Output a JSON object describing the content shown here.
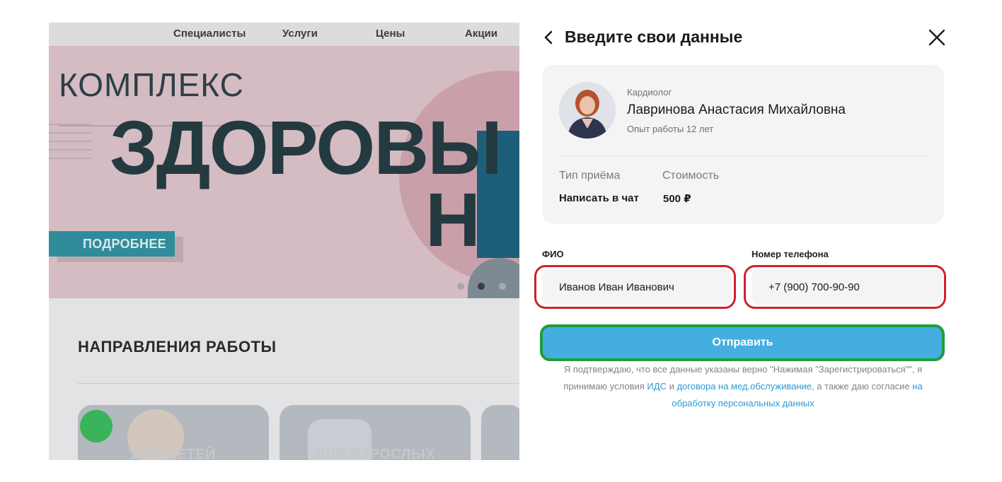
{
  "site": {
    "nav": [
      "Специалисты",
      "Услуги",
      "Цены",
      "Акции"
    ],
    "banner": {
      "small_title": "КОМПЛЕКС",
      "big_title": "ЗДОРОВЫ",
      "big_title2": "Н",
      "button": "ПОДРОБНЕЕ"
    },
    "section_title": "НАПРАВЛЕНИЯ РАБОТЫ",
    "cards": [
      "ДЛЯ ДЕТЕЙ",
      "ДЛЯ ВЗРОСЛЫХ"
    ]
  },
  "form": {
    "title": "Введите свои данные",
    "doctor": {
      "specialty": "Кардиолог",
      "name": "Лавринова Анастасия Михайловна",
      "experience": "Опыт работы 12 лет"
    },
    "appointment": {
      "type_label": "Тип приёма",
      "type_value": "Написать в чат",
      "cost_label": "Стоимость",
      "cost_value": "500 ₽"
    },
    "fields": {
      "name_label": "ФИО",
      "name_value": "Иванов Иван Иванович",
      "phone_label": "Номер телефона",
      "phone_value": "+7 (900) 700-90-90"
    },
    "submit_label": "Отправить",
    "consent": {
      "text1": "Я подтверждаю, что все данные указаны верно \"Нажимая \"Зарегистрироваться\"\", я принимаю условия ",
      "link1": "ИДС",
      "text2": " и ",
      "link2": "договора на мед.обслуживание",
      "text3": ", а также даю согласие ",
      "link3": "на обработку персональных данных"
    }
  },
  "colors": {
    "accent": "#45aee0",
    "annotation_red": "#d0212b",
    "annotation_green": "#1e9e3e",
    "link": "#2c9bd1"
  }
}
